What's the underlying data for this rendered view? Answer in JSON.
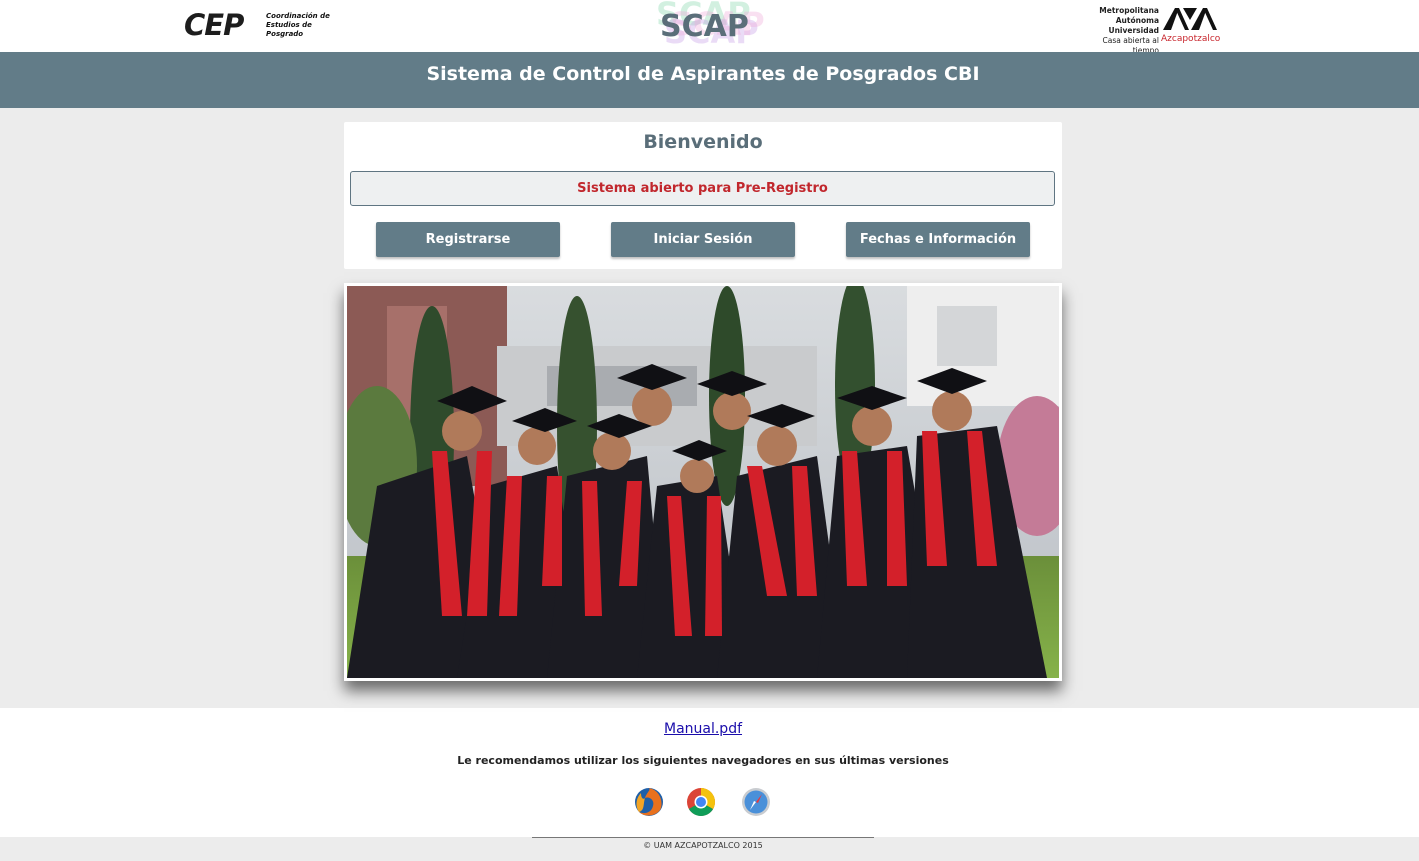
{
  "header": {
    "cep_mark": "CEP",
    "cep_text": "Coordinación de Estudios de Posgrado",
    "scap_title": "SCAP",
    "uam_lines": [
      "Universidad",
      "Autónoma",
      "Metropolitana"
    ],
    "uam_tagline": "Casa abierta al tiempo",
    "uam_campus": "Azcapotzalco"
  },
  "banner": {
    "title": "Sistema de Control de Aspirantes de Posgrados CBI"
  },
  "welcome": {
    "title": "Bienvenido",
    "status": "Sistema abierto para Pre-Registro",
    "buttons": {
      "register": "Registrarse",
      "login": "Iniciar Sesión",
      "info": "Fechas e Información"
    }
  },
  "links": {
    "manual": "Manual.pdf"
  },
  "browsers": {
    "recommendation": "Le recomendamos utilizar los siguientes navegadores en sus últimas versiones",
    "items": [
      "firefox-icon",
      "chrome-icon",
      "safari-icon"
    ]
  },
  "footer": {
    "copyright": "© UAM AZCAPOTZALCO 2015"
  },
  "colors": {
    "banner": "#627c88",
    "accent_red": "#c1272d",
    "background": "#ececec"
  }
}
